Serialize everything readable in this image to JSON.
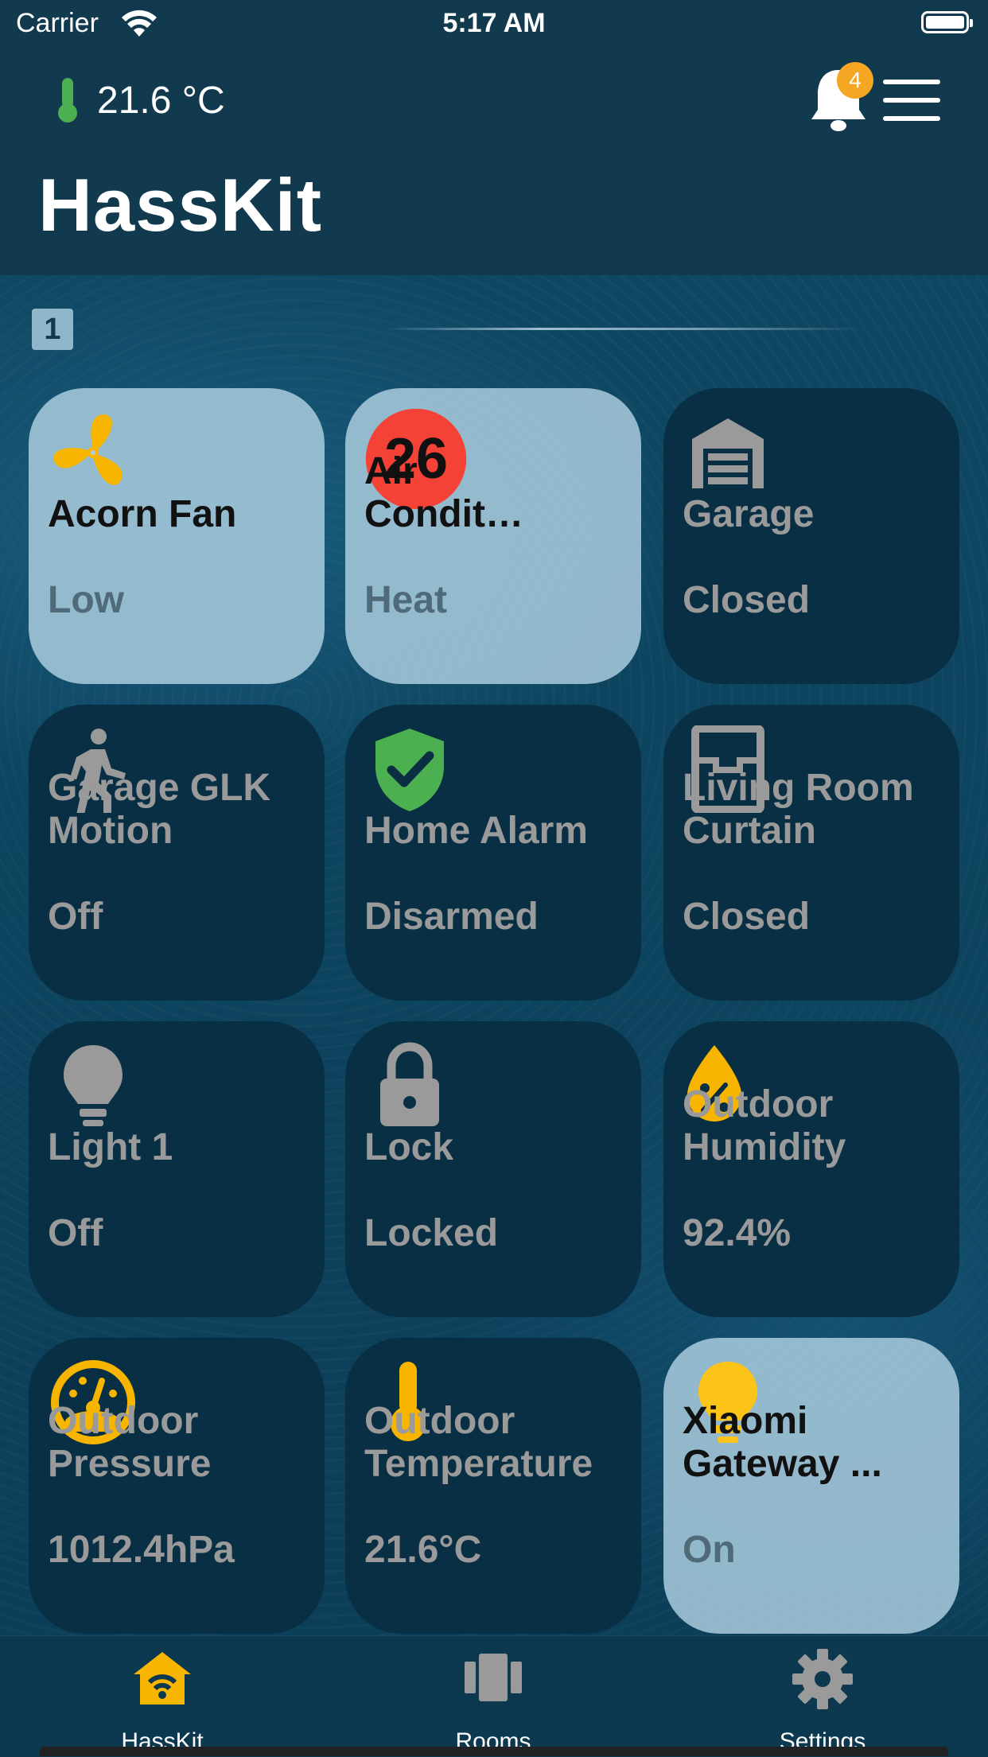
{
  "status_bar": {
    "carrier": "Carrier",
    "time": "5:17 AM"
  },
  "header": {
    "temperature": "21.6 °C",
    "notification_count": "4",
    "title": "HassKit"
  },
  "section": {
    "number": "1"
  },
  "tiles": [
    {
      "name": "Acorn Fan",
      "state": "Low",
      "icon": "fan-icon",
      "on": true
    },
    {
      "name": "Air Conditione...",
      "state": "Heat",
      "icon": "thermostat-badge",
      "badge_value": "26",
      "on": true
    },
    {
      "name": "Garage",
      "state": "Closed",
      "icon": "garage-icon",
      "on": false
    },
    {
      "name": "Garage GLK Motion",
      "state": "Off",
      "icon": "walking-person-icon",
      "on": false
    },
    {
      "name": "Home Alarm",
      "state": "Disarmed",
      "icon": "shield-check-icon",
      "on": false
    },
    {
      "name": "Living Room Curtain",
      "state": "Closed",
      "icon": "window-icon",
      "on": false
    },
    {
      "name": "Light 1",
      "state": "Off",
      "icon": "lightbulb-icon",
      "on": false
    },
    {
      "name": "Lock",
      "state": "Locked",
      "icon": "lock-icon",
      "on": false
    },
    {
      "name": "Outdoor Humidity",
      "state": "92.4%",
      "icon": "humidity-drop-icon",
      "on": false
    },
    {
      "name": "Outdoor Pressure",
      "state": "1012.4hPa",
      "icon": "gauge-icon",
      "on": false
    },
    {
      "name": "Outdoor Temperature",
      "state": "21.6°C",
      "icon": "thermometer-icon",
      "on": false
    },
    {
      "name": "Xiaomi Gateway ...",
      "state": "On",
      "icon": "lightbulb-icon",
      "on": true
    }
  ],
  "tab_bar": {
    "items": [
      {
        "label": "HassKit",
        "icon": "home-wifi-icon",
        "active": true
      },
      {
        "label": "Rooms",
        "icon": "rooms-icon",
        "active": false
      },
      {
        "label": "Settings",
        "icon": "gear-icon",
        "active": false
      }
    ]
  },
  "colors": {
    "accent": "#f5a623",
    "icon_yellow": "#f7b500",
    "alarm_green": "#4caf50",
    "badge_red": "#f44336",
    "inactive": "#9a9a9a"
  }
}
